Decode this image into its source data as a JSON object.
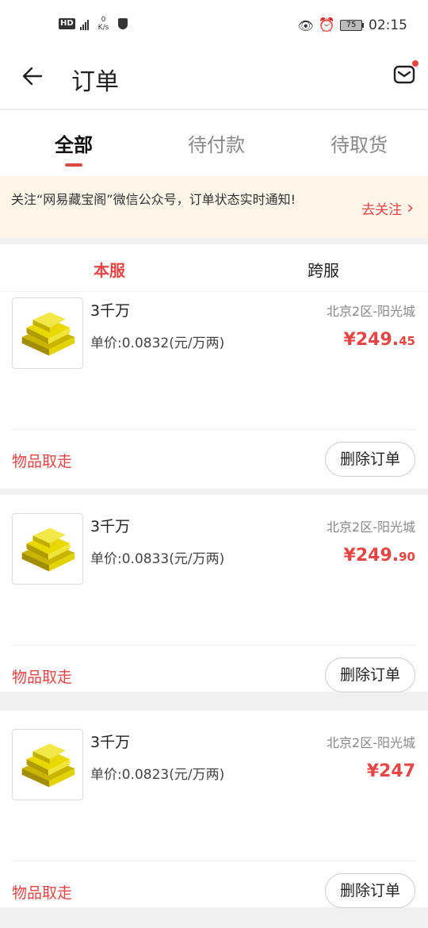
{
  "status_bar": {
    "hd": "HD",
    "net_rate": "0",
    "net_unit": "K/s",
    "battery": "75",
    "time": "02:15"
  },
  "header": {
    "title": "订单"
  },
  "tabs": [
    {
      "label": "全部",
      "active": true
    },
    {
      "label": "待付款",
      "active": false
    },
    {
      "label": "待取货",
      "active": false
    }
  ],
  "notice": {
    "text": "关注“网易藏宝阁”微信公众号，订单状态实时通知!",
    "action": "去关注"
  },
  "subtabs": [
    {
      "label": "本服",
      "active": true
    },
    {
      "label": "跨服",
      "active": false
    }
  ],
  "orders": [
    {
      "name": "3千万",
      "unit_price": "单价:0.0832(元/万两)",
      "server": "北京2区-阳光城",
      "total_int": "¥249.",
      "total_dec": "45",
      "status": "物品取走",
      "action": "删除订单"
    },
    {
      "name": "3千万",
      "unit_price": "单价:0.0833(元/万两)",
      "server": "北京2区-阳光城",
      "total_int": "¥249.",
      "total_dec": "90",
      "status": "物品取走",
      "action": "删除订单"
    },
    {
      "name": "3千万",
      "unit_price": "单价:0.0823(元/万两)",
      "server": "北京2区-阳光城",
      "total_int": "¥247",
      "total_dec": "",
      "status": "物品取走",
      "action": "删除订单"
    }
  ],
  "colors": {
    "accent": "#e54545",
    "notice_bg": "#fdf5e8"
  }
}
